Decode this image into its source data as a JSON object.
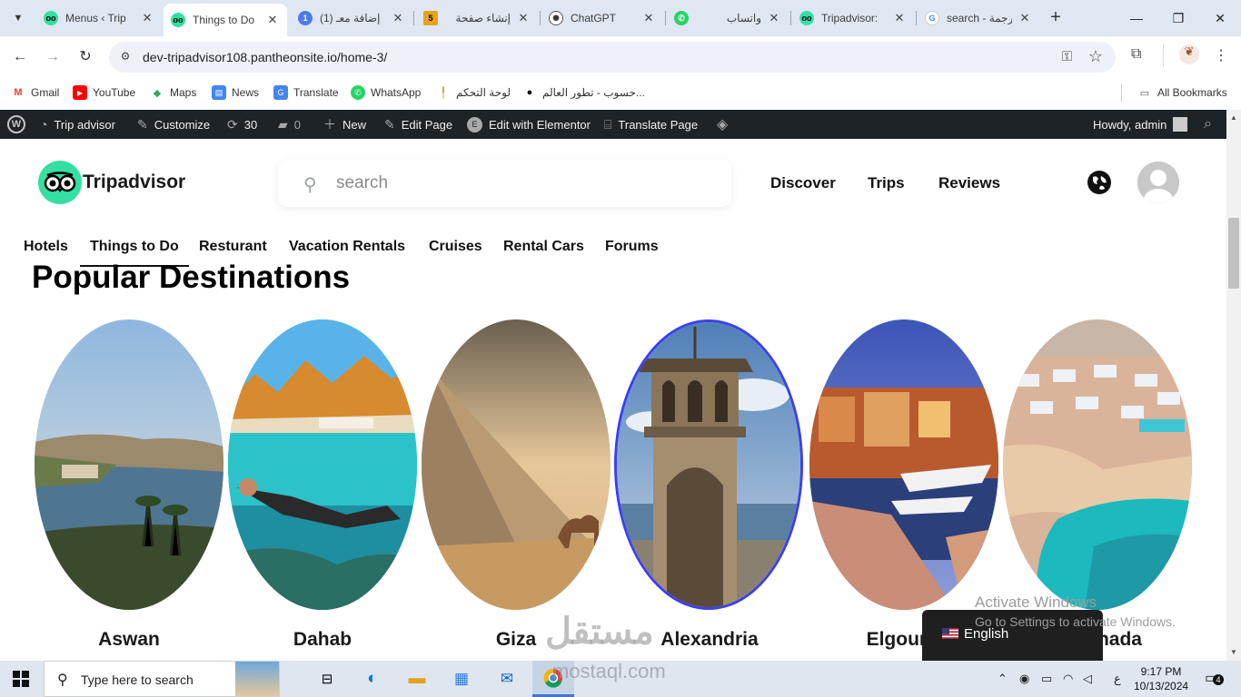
{
  "browser": {
    "tabs": [
      {
        "title": "Menus ‹ Trip",
        "icon": "tripadvisor-owl-icon",
        "active": false
      },
      {
        "title": "Things to Do",
        "icon": "tripadvisor-owl-icon",
        "active": true
      },
      {
        "title": "(1) إضافة معـ",
        "icon": "notification-icon",
        "active": false
      },
      {
        "title": "إنشاء صفحة",
        "icon": "five-icon",
        "active": false
      },
      {
        "title": "ChatGPT",
        "icon": "chatgpt-icon",
        "active": false
      },
      {
        "title": "واتساب",
        "icon": "whatsapp-icon",
        "active": false
      },
      {
        "title": "Tripadvisor:",
        "icon": "tripadvisor-owl-icon",
        "active": false
      },
      {
        "title": "search - ترجمة",
        "icon": "google-icon",
        "active": false
      }
    ],
    "url": "dev-tripadvisor108.pantheonsite.io/home-3/",
    "bookmarks": [
      {
        "label": "Gmail",
        "icon": "gmail-icon"
      },
      {
        "label": "YouTube",
        "icon": "youtube-icon"
      },
      {
        "label": "Maps",
        "icon": "maps-icon"
      },
      {
        "label": "News",
        "icon": "news-icon"
      },
      {
        "label": "Translate",
        "icon": "translate-icon"
      },
      {
        "label": "WhatsApp",
        "icon": "whatsapp-icon"
      },
      {
        "label": "لوحة التحكم",
        "icon": "dashboard-icon"
      },
      {
        "label": "حسوب - تطور العالم...",
        "icon": "hsoub-icon"
      }
    ],
    "all_bookmarks": "All Bookmarks"
  },
  "adminbar": {
    "site": "Trip advisor",
    "customize": "Customize",
    "updates": "30",
    "comments": "0",
    "new": "New",
    "edit_page": "Edit Page",
    "elementor": "Edit with Elementor",
    "translate": "Translate Page",
    "howdy": "Howdy, admin"
  },
  "header": {
    "logo": "Tripadvisor",
    "search_placeholder": "search",
    "nav": [
      "Discover",
      "Trips",
      "Reviews"
    ]
  },
  "subnav": [
    "Hotels",
    "Things to Do",
    "Resturant",
    "Vacation Rentals",
    "Cruises",
    "Rental Cars",
    "Forums"
  ],
  "section_title": "Popular Destinations",
  "destinations": [
    {
      "name": "Aswan"
    },
    {
      "name": "Dahab"
    },
    {
      "name": "Giza"
    },
    {
      "name": "Alexandria"
    },
    {
      "name": "Elgouna"
    },
    {
      "name": "Hurghada"
    }
  ],
  "overlay": {
    "activate_title": "Activate Windows",
    "activate_sub": "Go to Settings to activate Windows.",
    "language": "English",
    "watermark_ar": "مستقل",
    "watermark_en": "mostaql.com"
  },
  "taskbar": {
    "search_placeholder": "Type here to search",
    "time": "9:17 PM",
    "date": "10/13/2024",
    "lang": "ع",
    "notifications": "4"
  },
  "colors": {
    "accent": "#34e0a1",
    "adminbar": "#1d2327",
    "selected_border": "#3a3ff0"
  }
}
